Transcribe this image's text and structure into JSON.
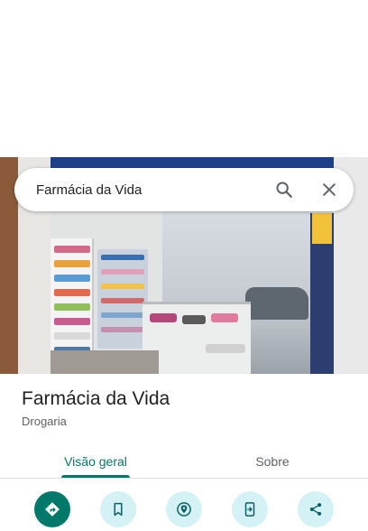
{
  "search": {
    "query": "Farmácia da Vida"
  },
  "place": {
    "name": "Farmácia da Vida",
    "category": "Drogaria"
  },
  "tabs": [
    {
      "label": "Visão geral",
      "active": true
    },
    {
      "label": "Sobre",
      "active": false
    }
  ],
  "actions": [
    {
      "icon": "directions-icon",
      "style": "primary"
    },
    {
      "icon": "bookmark-icon",
      "style": "secondary"
    },
    {
      "icon": "nearby-icon",
      "style": "secondary"
    },
    {
      "icon": "send-to-phone-icon",
      "style": "secondary"
    },
    {
      "icon": "share-icon",
      "style": "secondary"
    }
  ],
  "colors": {
    "accent": "#00796b",
    "action_bg": "#d4f1f5",
    "text_primary": "#202124",
    "text_secondary": "#5f6368"
  }
}
